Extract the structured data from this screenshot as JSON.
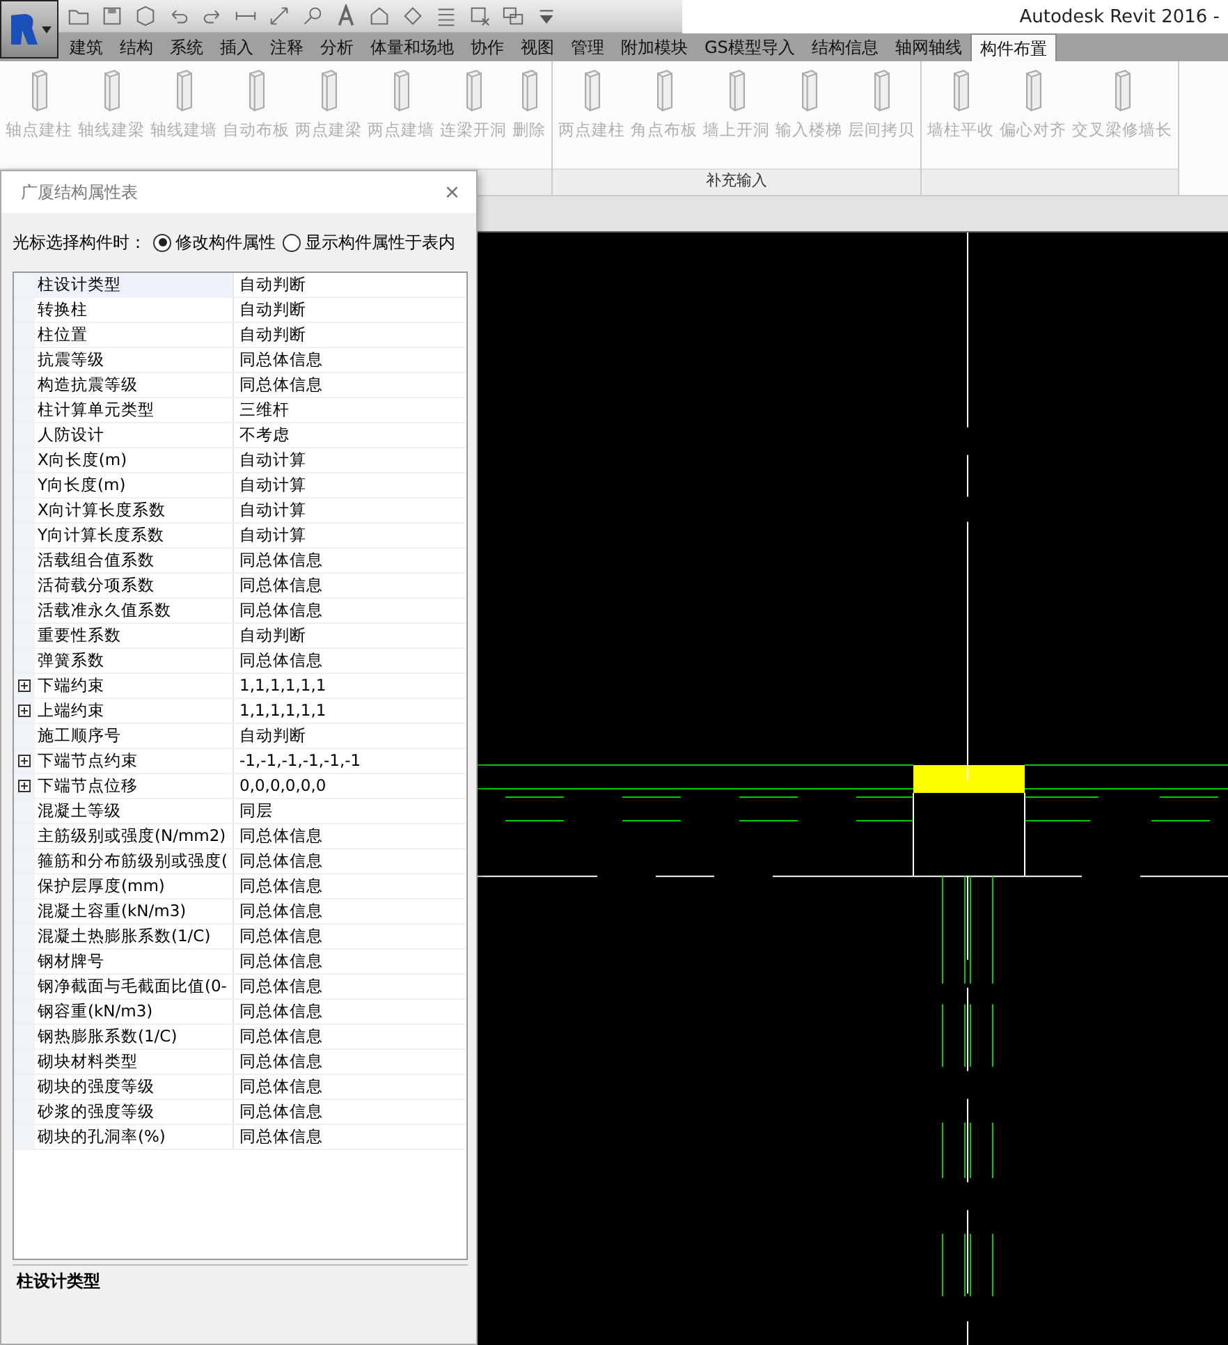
{
  "window": {
    "title": "Autodesk Revit 2016 -"
  },
  "tabs": [
    {
      "label": "建筑",
      "selected": false
    },
    {
      "label": "结构",
      "selected": false
    },
    {
      "label": "系统",
      "selected": false
    },
    {
      "label": "插入",
      "selected": false
    },
    {
      "label": "注释",
      "selected": false
    },
    {
      "label": "分析",
      "selected": false
    },
    {
      "label": "体量和场地",
      "selected": false
    },
    {
      "label": "协作",
      "selected": false
    },
    {
      "label": "视图",
      "selected": false
    },
    {
      "label": "管理",
      "selected": false
    },
    {
      "label": "附加模块",
      "selected": false
    },
    {
      "label": "GS模型导入",
      "selected": false
    },
    {
      "label": "结构信息",
      "selected": false
    },
    {
      "label": "轴网轴线",
      "selected": false
    },
    {
      "label": "构件布置",
      "selected": true
    }
  ],
  "ribbon": {
    "panels": [
      {
        "tools": [
          "轴点建柱",
          "轴线建梁",
          "轴线建墙",
          "自动布板",
          "两点建梁",
          "两点建墙",
          "连梁开洞",
          "删除"
        ]
      },
      {
        "label": "补充输入",
        "tools": [
          "两点建柱",
          "角点布板",
          "墙上开洞",
          "输入楼梯",
          "层间拷贝"
        ]
      },
      {
        "tools": [
          "墙柱平收",
          "偏心对齐",
          "交叉梁修墙长"
        ]
      }
    ]
  },
  "dialog": {
    "title": "广厦结构属性表",
    "close": "×",
    "mode": {
      "label": "光标选择构件时：",
      "options": [
        {
          "label": "修改构件属性",
          "selected": true
        },
        {
          "label": "显示构件属性于表内",
          "selected": false
        }
      ]
    },
    "rows": [
      {
        "name": "柱设计类型",
        "value": "自动判断",
        "expandable": false,
        "selected": true
      },
      {
        "name": "转换柱",
        "value": "自动判断",
        "expandable": false,
        "selected": false
      },
      {
        "name": "柱位置",
        "value": "自动判断",
        "expandable": false,
        "selected": false
      },
      {
        "name": "抗震等级",
        "value": "同总体信息",
        "expandable": false,
        "selected": false
      },
      {
        "name": "构造抗震等级",
        "value": "同总体信息",
        "expandable": false,
        "selected": false
      },
      {
        "name": "柱计算单元类型",
        "value": "三维杆",
        "expandable": false,
        "selected": false
      },
      {
        "name": "人防设计",
        "value": "不考虑",
        "expandable": false,
        "selected": false
      },
      {
        "name": "X向长度(m)",
        "value": "自动计算",
        "expandable": false,
        "selected": false
      },
      {
        "name": "Y向长度(m)",
        "value": "自动计算",
        "expandable": false,
        "selected": false
      },
      {
        "name": "X向计算长度系数",
        "value": "自动计算",
        "expandable": false,
        "selected": false
      },
      {
        "name": "Y向计算长度系数",
        "value": "自动计算",
        "expandable": false,
        "selected": false
      },
      {
        "name": "活载组合值系数",
        "value": "同总体信息",
        "expandable": false,
        "selected": false
      },
      {
        "name": "活荷载分项系数",
        "value": "同总体信息",
        "expandable": false,
        "selected": false
      },
      {
        "name": "活载准永久值系数",
        "value": "同总体信息",
        "expandable": false,
        "selected": false
      },
      {
        "name": "重要性系数",
        "value": "自动判断",
        "expandable": false,
        "selected": false
      },
      {
        "name": "弹簧系数",
        "value": "同总体信息",
        "expandable": false,
        "selected": false
      },
      {
        "name": "下端约束",
        "value": "1,1,1,1,1,1",
        "expandable": true,
        "selected": false
      },
      {
        "name": "上端约束",
        "value": "1,1,1,1,1,1",
        "expandable": true,
        "selected": false
      },
      {
        "name": "施工顺序号",
        "value": "自动判断",
        "expandable": false,
        "selected": false
      },
      {
        "name": "下端节点约束",
        "value": "-1,-1,-1,-1,-1,-1",
        "expandable": true,
        "selected": false
      },
      {
        "name": "下端节点位移",
        "value": "0,0,0,0,0,0",
        "expandable": true,
        "selected": false
      },
      {
        "name": "混凝土等级",
        "value": "同层",
        "expandable": false,
        "selected": false
      },
      {
        "name": "主筋级别或强度(N/mm2)",
        "value": "同总体信息",
        "expandable": false,
        "selected": false
      },
      {
        "name": "箍筋和分布筋级别或强度(",
        "value": "同总体信息",
        "expandable": false,
        "selected": false
      },
      {
        "name": "保护层厚度(mm)",
        "value": "同总体信息",
        "expandable": false,
        "selected": false
      },
      {
        "name": "混凝土容重(kN/m3)",
        "value": "同总体信息",
        "expandable": false,
        "selected": false
      },
      {
        "name": "混凝土热膨胀系数(1/C)",
        "value": "同总体信息",
        "expandable": false,
        "selected": false
      },
      {
        "name": "钢材牌号",
        "value": "同总体信息",
        "expandable": false,
        "selected": false
      },
      {
        "name": "钢净截面与毛截面比值(0-",
        "value": "同总体信息",
        "expandable": false,
        "selected": false
      },
      {
        "name": "钢容重(kN/m3)",
        "value": "同总体信息",
        "expandable": false,
        "selected": false
      },
      {
        "name": "钢热膨胀系数(1/C)",
        "value": "同总体信息",
        "expandable": false,
        "selected": false
      },
      {
        "name": "砌块材料类型",
        "value": "同总体信息",
        "expandable": false,
        "selected": false
      },
      {
        "name": "砌块的强度等级",
        "value": "同总体信息",
        "expandable": false,
        "selected": false
      },
      {
        "name": "砂浆的强度等级",
        "value": "同总体信息",
        "expandable": false,
        "selected": false
      },
      {
        "name": "砌块的孔洞率(%)",
        "value": "同总体信息",
        "expandable": false,
        "selected": false
      }
    ],
    "description": "柱设计类型"
  }
}
